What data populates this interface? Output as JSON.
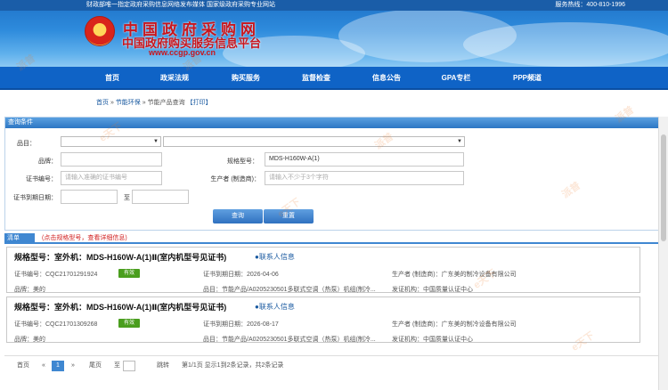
{
  "topbar": {
    "left": "财政部唯一指定政府采购信息网络发布媒体 国家级政府采购专业网站",
    "right": "服务热线：400-810-1996"
  },
  "site": {
    "name": "中国政府采购网",
    "subname": "中国政府购买服务信息平台",
    "url": "www.ccgp.gov.cn"
  },
  "nav": [
    "首页",
    "政采法规",
    "购买服务",
    "监督检查",
    "信息公告",
    "GPA专栏",
    "PPP频道"
  ],
  "breadcrumb": {
    "home": "首页",
    "sep": "»",
    "cat": "节能环保",
    "page": "节能产品查询",
    "print": "【打印】"
  },
  "query": {
    "title": "查询条件",
    "labels": {
      "category": "品目：",
      "brand": "品牌：",
      "model": "规格型号：",
      "cert_no": "证书编号：",
      "maker": "生产者 (制造商)：",
      "expiry": "证书到期日期：",
      "to": "至"
    },
    "model_value": "MDS-H160W-A(1)",
    "cert_placeholder": "请输入准确的证书编号",
    "maker_placeholder": "请输入不少于3个字符",
    "search": "查询",
    "reset": "重置"
  },
  "list": {
    "tab": "清单",
    "tip": "(点击规格型号，查看详细信息)"
  },
  "labels": {
    "model": "规格型号：",
    "cert_no": "证书编号：",
    "expiry": "证书到期日期：",
    "maker": "生产者 (制造商)：",
    "brand": "品牌：",
    "category": "品目：",
    "issuer": "发证机构："
  },
  "contact_label": "联系人信息",
  "results": [
    {
      "model": "室外机：MDS-H160W-A(1)Ⅱ(室内机型号见证书)",
      "cert_no": "CQC21701291924",
      "status": "有效",
      "expiry": "2026-04-06",
      "maker": "广东美的制冷设备有限公司",
      "brand": "美的",
      "category": "节能产品/A0205230501多联式空调（热泵）机组(制冷...",
      "issuer": "中国质量认证中心"
    },
    {
      "model": "室外机：MDS-H160W-A(1)Ⅱ(室内机型号见证书)",
      "cert_no": "CQC21701309268",
      "status": "有效",
      "expiry": "2026-08-17",
      "maker": "广东美的制冷设备有限公司",
      "brand": "美的",
      "category": "节能产品/A0205230501多联式空调（热泵）机组(制冷...",
      "issuer": "中国质量认证中心"
    }
  ],
  "pager": {
    "first": "首页",
    "prev": "«",
    "current": "1",
    "next": "»",
    "last": "尾页",
    "goto": "至",
    "jump": "跳转",
    "info": "第1/1页 显示1到2条记录，共2条记录"
  },
  "watermark": [
    "派普",
    "e天下"
  ]
}
